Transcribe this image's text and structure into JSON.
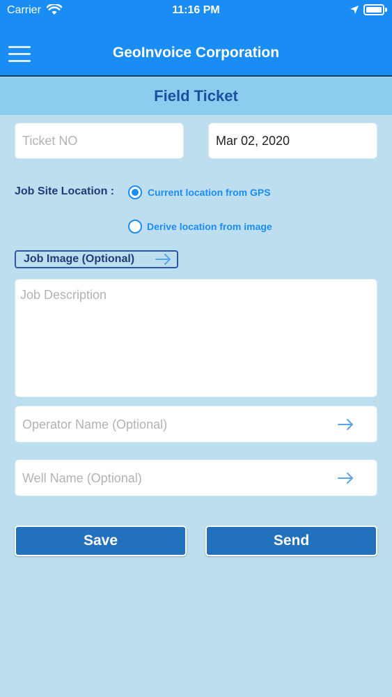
{
  "status_bar": {
    "carrier": "Carrier",
    "time": "11:16 PM",
    "wifi_icon": "wifi-icon",
    "location_icon": "location-arrow-icon",
    "battery_icon": "battery-icon"
  },
  "header": {
    "title": "GeoInvoice Corporation",
    "menu_icon": "hamburger-menu-icon"
  },
  "page": {
    "title": "Field Ticket"
  },
  "form": {
    "ticket_no": {
      "placeholder": "Ticket NO",
      "value": ""
    },
    "date": {
      "value": "Mar 02, 2020"
    },
    "job_site": {
      "label": "Job Site Location :",
      "options": [
        {
          "label": "Current location from GPS",
          "selected": true
        },
        {
          "label": "Derive location from image",
          "selected": false
        }
      ]
    },
    "job_image": {
      "label": "Job Image (Optional)",
      "icon": "arrow-right-icon"
    },
    "job_description": {
      "placeholder": "Job Description",
      "value": ""
    },
    "operator_name": {
      "placeholder": "Operator Name (Optional)",
      "icon": "arrow-right-icon"
    },
    "well_name": {
      "placeholder": "Well Name (Optional)",
      "icon": "arrow-right-icon"
    }
  },
  "actions": {
    "save": "Save",
    "send": "Send"
  },
  "colors": {
    "header": "#1a8df5",
    "subheader": "#8cccee",
    "background": "#bcdeee",
    "button": "#2171bd",
    "accent": "#1a8df5"
  }
}
